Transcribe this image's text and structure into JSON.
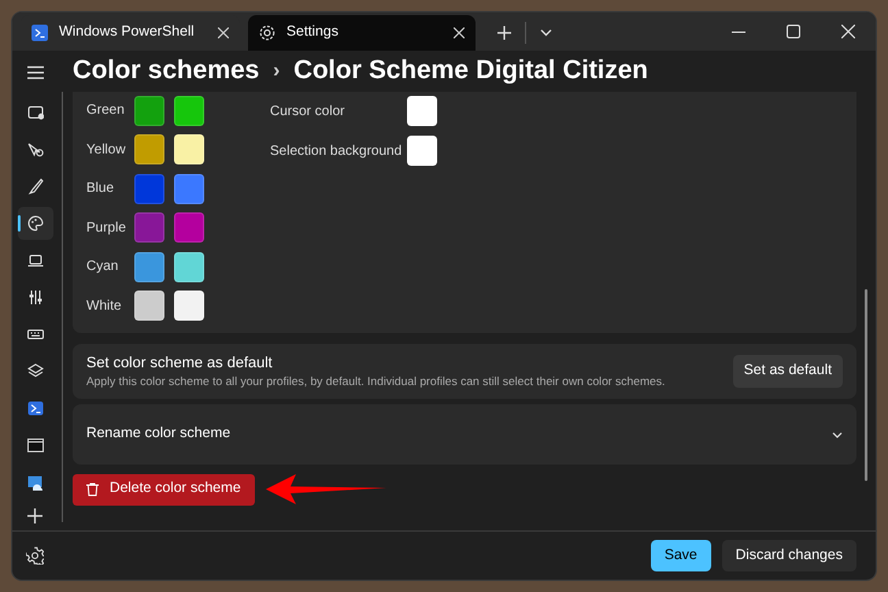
{
  "tabs": [
    {
      "label": "Windows PowerShell",
      "selected": false
    },
    {
      "label": "Settings",
      "selected": true
    }
  ],
  "breadcrumb": [
    "Color schemes",
    "›",
    "Color Scheme Digital Citizen"
  ],
  "sidebar_items": [
    {
      "selected": false
    },
    {
      "selected": false
    },
    {
      "selected": false
    },
    {
      "selected": true
    },
    {
      "selected": false
    },
    {
      "selected": false
    },
    {
      "selected": false
    },
    {
      "selected": false
    },
    {
      "selected": false
    },
    {
      "selected": false
    },
    {
      "selected": false
    }
  ],
  "terminal_colors": [
    {
      "name": "Green",
      "swatches": [
        {
          "color": "#13a10e"
        },
        {
          "color": "#16c60c"
        }
      ]
    },
    {
      "name": "Yellow",
      "swatches": [
        {
          "color": "#c19c00"
        },
        {
          "color": "#f9f1a5"
        }
      ]
    },
    {
      "name": "Blue",
      "swatches": [
        {
          "color": "#0037da"
        },
        {
          "color": "#3b78ff"
        }
      ]
    },
    {
      "name": "Purple",
      "swatches": [
        {
          "color": "#881798"
        },
        {
          "color": "#b4009e"
        }
      ]
    },
    {
      "name": "Cyan",
      "swatches": [
        {
          "color": "#3a96dd"
        },
        {
          "color": "#61d6d6"
        }
      ]
    },
    {
      "name": "White",
      "swatches": [
        {
          "color": "#cccccc"
        },
        {
          "color": "#f2f2f2"
        }
      ]
    }
  ],
  "system_colors": [
    {
      "name": "Cursor color",
      "color": "#ffffff"
    },
    {
      "name": "Selection background",
      "color": "#ffffff"
    }
  ],
  "default_card": {
    "title": "Set color scheme as default",
    "description": "Apply this color scheme to all your profiles, by default. Individual profiles can still select their own color schemes.",
    "button": "Set as default"
  },
  "rename_card": {
    "title": "Rename color scheme",
    "expanded": false
  },
  "delete_button": "Delete color scheme",
  "footer_buttons": [
    "Save",
    "Discard changes"
  ]
}
